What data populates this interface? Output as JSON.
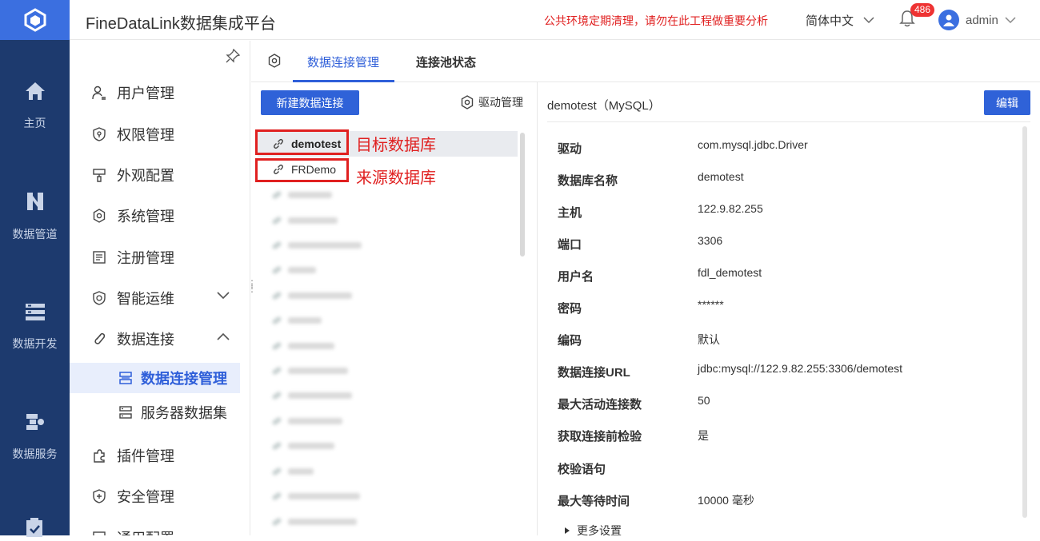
{
  "app": {
    "title": "FineDataLink数据集成平台"
  },
  "header": {
    "notice": "公共环境定期清理，请勿在此工程做重要分析",
    "language": "简体中文",
    "notification_count": "486",
    "username": "admin"
  },
  "rail": [
    {
      "label": "主页",
      "icon": "home-icon"
    },
    {
      "label": "数据管道",
      "icon": "pipeline-icon"
    },
    {
      "label": "数据开发",
      "icon": "dev-icon"
    },
    {
      "label": "数据服务",
      "icon": "service-icon"
    }
  ],
  "sidenav": {
    "items": [
      {
        "label": "用户管理",
        "icon": "user-manage-icon"
      },
      {
        "label": "权限管理",
        "icon": "permission-icon"
      },
      {
        "label": "外观配置",
        "icon": "appearance-icon"
      },
      {
        "label": "系统管理",
        "icon": "system-gear-icon"
      },
      {
        "label": "注册管理",
        "icon": "register-icon"
      },
      {
        "label": "智能运维",
        "icon": "ops-icon"
      },
      {
        "label": "数据连接",
        "icon": "link-icon"
      },
      {
        "label": "插件管理",
        "icon": "plugin-icon"
      },
      {
        "label": "安全管理",
        "icon": "security-icon"
      },
      {
        "label": "通用配置",
        "icon": "config-icon"
      }
    ],
    "sub_items": [
      {
        "label": "数据连接管理",
        "icon": "connection-manage-icon",
        "active": true
      },
      {
        "label": "服务器数据集",
        "icon": "server-dataset-icon",
        "active": false
      }
    ]
  },
  "tabs": [
    {
      "label": "数据连接管理",
      "active": true
    },
    {
      "label": "连接池状态",
      "active": false
    }
  ],
  "list": {
    "new_button": "新建数据连接",
    "driver_button": "驱动管理",
    "connections": [
      {
        "name": "demotest",
        "selected": true
      },
      {
        "name": "FRDemo",
        "selected": false
      }
    ],
    "annotations": {
      "target": "目标数据库",
      "source": "来源数据库"
    }
  },
  "detail": {
    "title": "demotest（MySQL）",
    "edit_button": "编辑",
    "fields": [
      {
        "key": "驱动",
        "value": "com.mysql.jdbc.Driver"
      },
      {
        "key": "数据库名称",
        "value": "demotest"
      },
      {
        "key": "主机",
        "value": "122.9.82.255"
      },
      {
        "key": "端口",
        "value": "3306"
      },
      {
        "key": "用户名",
        "value": "fdl_demotest"
      },
      {
        "key": "密码",
        "value": "******"
      },
      {
        "key": "编码",
        "value": "默认"
      },
      {
        "key": "数据连接URL",
        "value": "jdbc:mysql://122.9.82.255:3306/demotest"
      },
      {
        "key": "最大活动连接数",
        "value": "50"
      },
      {
        "key": "获取连接前检验",
        "value": "是"
      },
      {
        "key": "校验语句",
        "value": ""
      },
      {
        "key": "最大等待时间",
        "value": "10000 毫秒"
      }
    ],
    "more_settings": "更多设置"
  },
  "colors": {
    "rail_bg": "#1d3a6e",
    "accent": "#2f62d8",
    "annotation_red": "#e02020"
  }
}
